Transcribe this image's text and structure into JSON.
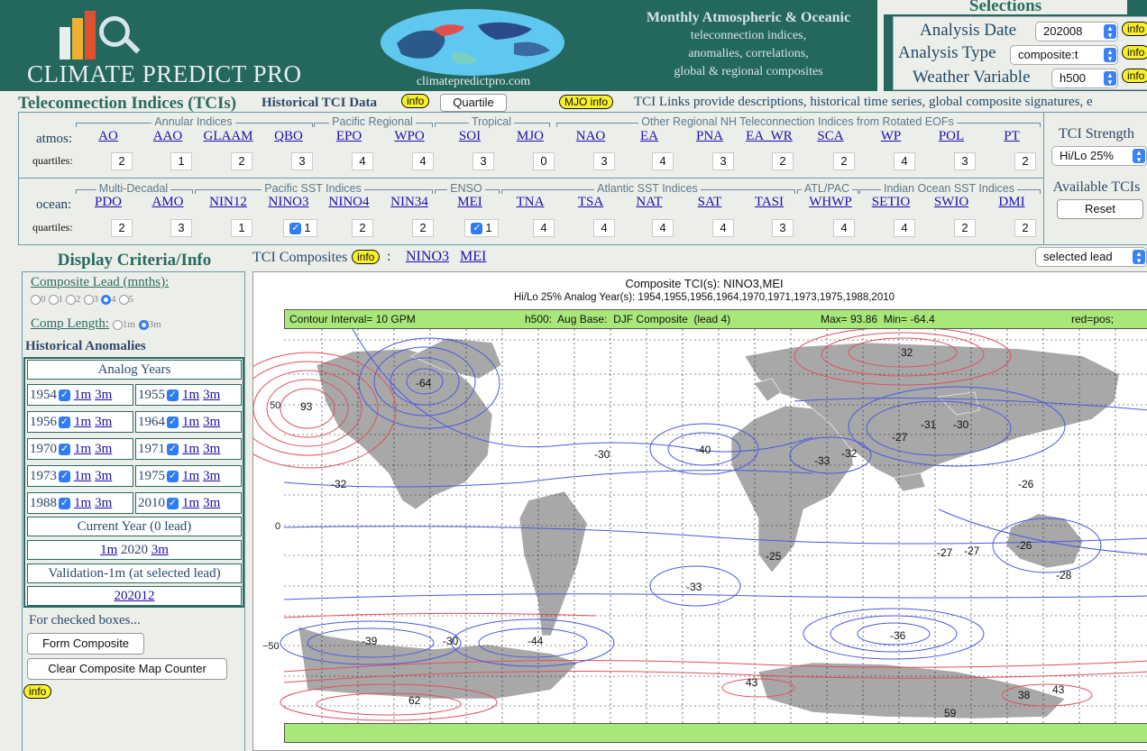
{
  "header": {
    "logo_text": "CLIMATE PREDICT PRO",
    "site_url": "climatepredictpro.com",
    "tagline": [
      "Monthly Atmospheric & Oceanic",
      "teleconnection indices,",
      "anomalies, correlations,",
      "global & regional composites"
    ]
  },
  "selections": {
    "title": "Selections",
    "analysis_date_label": "Analysis Date",
    "analysis_date_value": "202008",
    "analysis_type_label": "Analysis Type",
    "analysis_type_value": "composite:t",
    "weather_variable_label": "Weather Variable",
    "weather_variable_value": "h500",
    "info_label": "info"
  },
  "tci_bar": {
    "title": "Teleconnection Indices (TCIs)",
    "historical_label": "Historical TCI Data",
    "info_label": "info",
    "quartile_button": "Quartile",
    "mjo_info": "MJO info",
    "links_text": "TCI Links provide descriptions, historical time series, global composite signatures, e"
  },
  "atmos": {
    "row_label": "atmos:",
    "quartiles_label": "quartiles:",
    "groups": [
      "Annular Indices",
      "Pacific Regional",
      "Tropical",
      "Other Regional NH Teleconnection Indices from Rotated EOFs"
    ],
    "indices": [
      "AO",
      "AAO",
      "GLAAM",
      "QBO",
      "EPO",
      "WPO",
      "SOI",
      "MJO",
      "NAO",
      "EA",
      "PNA",
      "EA_WR",
      "SCA",
      "WP",
      "POL",
      "PT"
    ],
    "quartiles": [
      "2",
      "1",
      "2",
      "3",
      "4",
      "4",
      "3",
      "0",
      "3",
      "4",
      "3",
      "2",
      "2",
      "4",
      "3",
      "2"
    ]
  },
  "ocean": {
    "row_label": "ocean:",
    "quartiles_label": "quartiles:",
    "groups": [
      "Multi-Decadal",
      "Pacific SST Indices",
      "ENSO",
      "Atlantic SST Indices",
      "ATL/PAC",
      "Indian Ocean SST Indices"
    ],
    "indices": [
      "PDO",
      "AMO",
      "NIN12",
      "NINO3",
      "NINO4",
      "NIN34",
      "MEI",
      "TNA",
      "TSA",
      "NAT",
      "SAT",
      "TASI",
      "WHWP",
      "SETIO",
      "SWIO",
      "DMI"
    ],
    "quartiles": [
      "2",
      "3",
      "1",
      "1",
      "2",
      "2",
      "1",
      "4",
      "4",
      "4",
      "4",
      "3",
      "4",
      "4",
      "2",
      "2"
    ]
  },
  "strength": {
    "title": "TCI Strength",
    "value": "Hi/Lo 25%",
    "available_title": "Available TCIs",
    "reset_button": "Reset"
  },
  "display": {
    "title": "Display Criteria/Info",
    "lead_label": "Composite Lead (mnths):",
    "lead_options": [
      "0",
      "1",
      "2",
      "3",
      "4",
      "5"
    ],
    "comp_length_label": "Comp Length:",
    "comp_options": [
      "1m",
      "3m"
    ],
    "historical_title": "Historical Anomalies",
    "analog_title": "Analog Years",
    "analog_years": [
      "1954",
      "1955",
      "1956",
      "1964",
      "1970",
      "1971",
      "1973",
      "1975",
      "1988",
      "2010"
    ],
    "link_1m": "1m",
    "link_3m": "3m",
    "current_year_title": "Current Year (0 lead)",
    "current_year": "2020",
    "validation_title": "Validation-1m (at selected lead)",
    "validation_value": "202012",
    "for_checked": "For checked boxes...",
    "form_composite_button": "Form Composite",
    "clear_button": "Clear Composite Map Counter",
    "info_label": "info"
  },
  "composites_bar": {
    "label": "TCI Composites",
    "info_label": "info",
    "links": [
      "NINO3",
      "MEI"
    ],
    "lead_select": "selected lead"
  },
  "map": {
    "title": "Composite TCI(s): NINO3,MEI",
    "subtitle": "Hi/Lo 25% Analog Year(s): 1954,1955,1956,1964,1970,1971,1973,1975,1988,2010",
    "contour_interval": "Contour Interval= 10 GPM",
    "base_info": "h500:  Aug Base:  DJF Composite  (lead 4)",
    "maxmin": "Max= 93.86  Min= -64.4",
    "legend_text": "red=pos; blue=neg",
    "lat_labels": [
      "50",
      "0",
      "−50"
    ],
    "contour_labels": [
      "-64",
      "93",
      "32",
      "-30",
      "-40",
      "-33",
      "-32",
      "-27",
      "-31",
      "-30",
      "-26",
      "-32",
      "-25",
      "-27",
      "-27",
      "-26",
      "-28",
      "-33",
      "-39",
      "-30",
      "-44",
      "-36",
      "43",
      "62",
      "38",
      "43",
      "59"
    ],
    "colors": {
      "pos": "#e05060",
      "neg": "#4a5ae0",
      "land": "#a6a6a6",
      "band": "#a8e878"
    }
  }
}
